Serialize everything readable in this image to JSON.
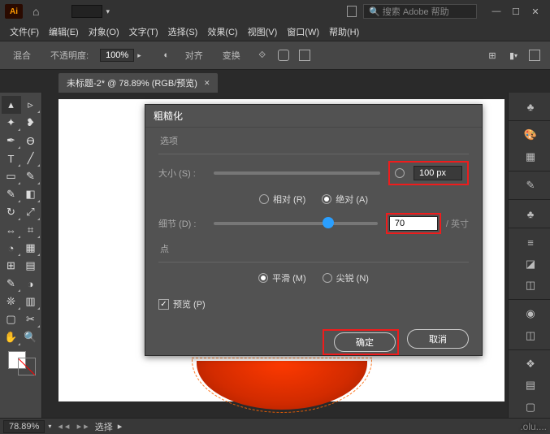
{
  "app": {
    "logo": "Ai",
    "search_placeholder": "搜索 Adobe 帮助"
  },
  "menu": {
    "file": "文件(F)",
    "edit": "编辑(E)",
    "object": "对象(O)",
    "type": "文字(T)",
    "select": "选择(S)",
    "effect": "效果(C)",
    "view": "视图(V)",
    "window": "窗口(W)",
    "help": "帮助(H)"
  },
  "control": {
    "mode_label": "混合",
    "opacity_label": "不透明度:",
    "opacity_value": "100%",
    "align_label": "对齐",
    "transform_label": "变换"
  },
  "tab": {
    "title": "未标题-2* @ 78.89% (RGB/预览)"
  },
  "status": {
    "zoom": "78.89%",
    "mode": "选择",
    "watermark": ".olu...."
  },
  "dialog": {
    "title": "粗糙化",
    "grp_options": "选项",
    "size_label": "大小 (S) :",
    "size_value": "100 px",
    "relative": "相对 (R)",
    "absolute": "绝对 (A)",
    "detail_label": "细节 (D) :",
    "detail_value": "70",
    "detail_unit": "/ 英寸",
    "grp_points": "点",
    "smooth": "平滑 (M)",
    "corner": "尖锐 (N)",
    "preview": "预览 (P)",
    "ok": "确定",
    "cancel": "取消"
  }
}
